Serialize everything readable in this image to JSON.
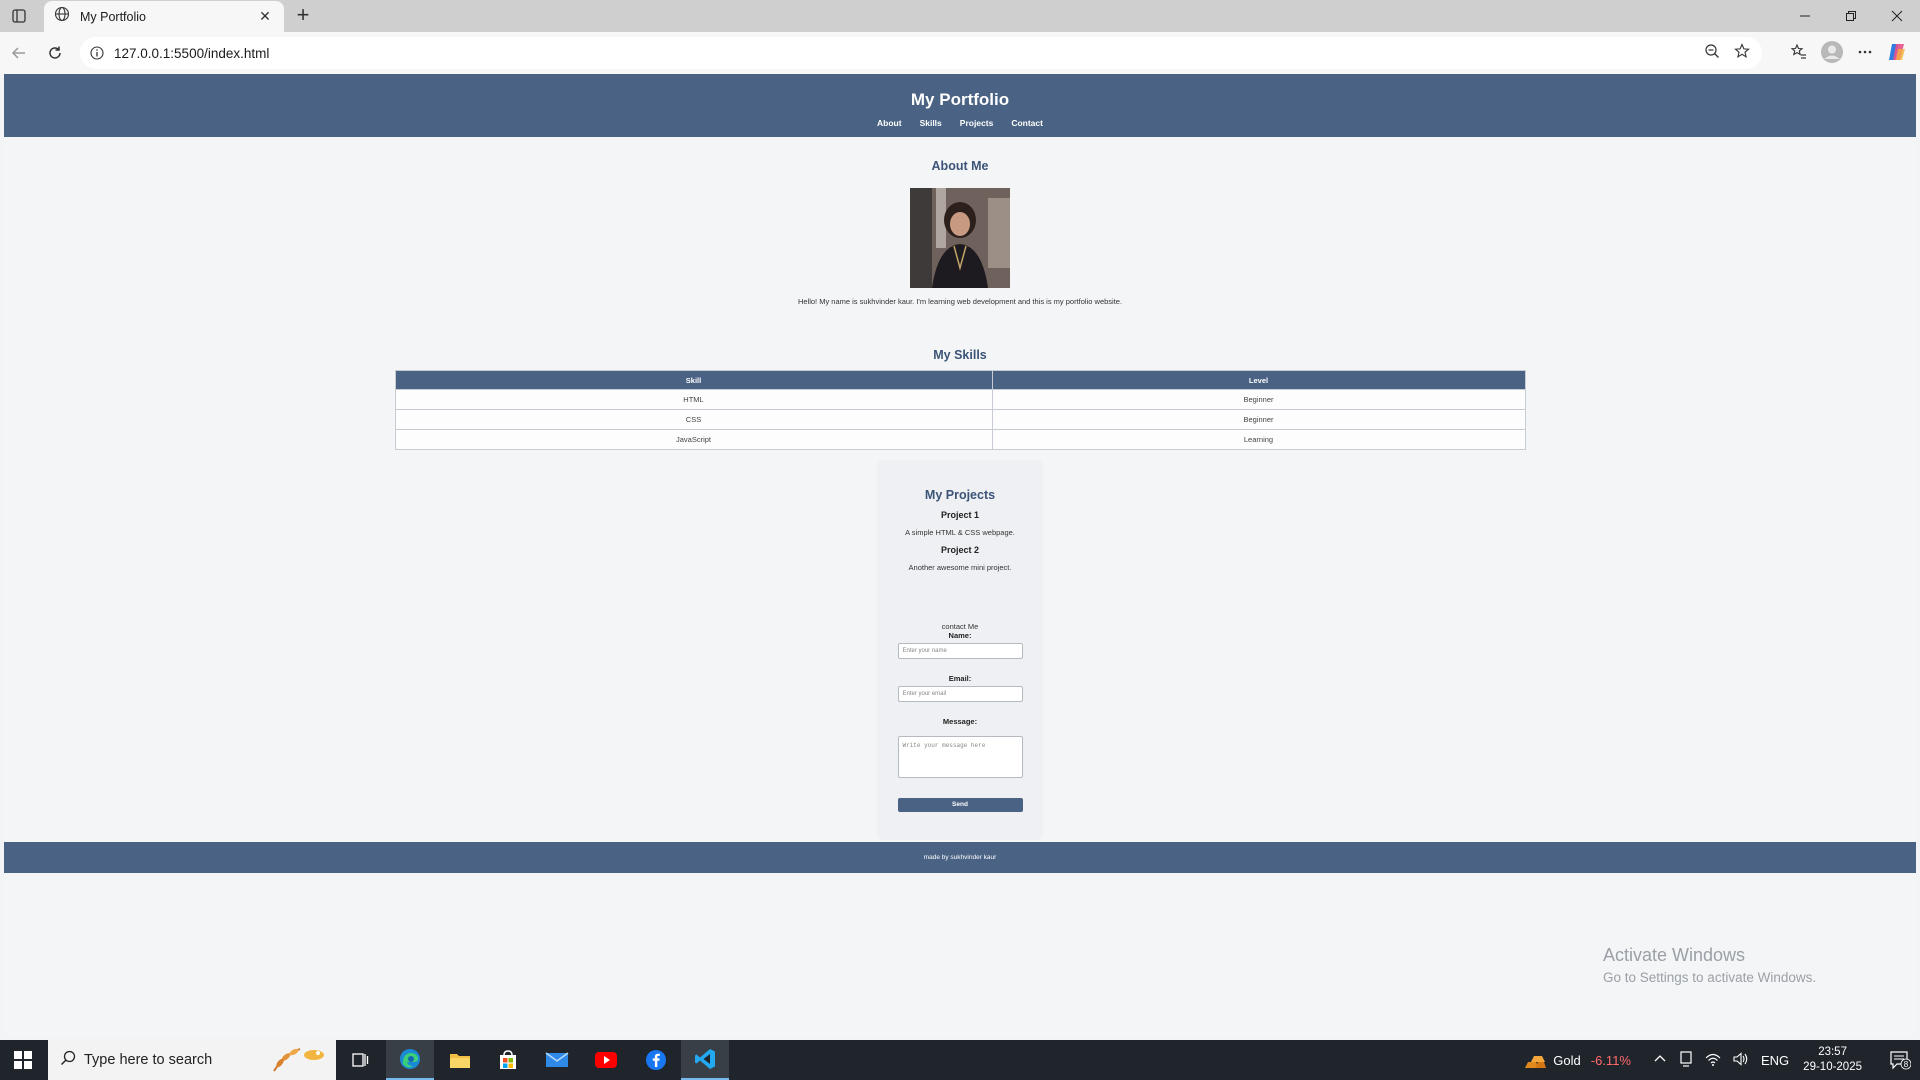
{
  "browser": {
    "tab_title": "My Portfolio",
    "tab_close": "✕",
    "new_tab": "+",
    "url": "127.0.0.1:5500/index.html"
  },
  "site": {
    "title": "My Portfolio",
    "nav": [
      "About",
      "Skills",
      "Projects",
      "Contact"
    ],
    "about": {
      "heading": "About Me",
      "text": "Hello! My name is sukhvinder kaur. I'm learning web development and this is my portfolio website."
    },
    "skills": {
      "heading": "My Skills",
      "headers": [
        "Skill",
        "Level"
      ],
      "rows": [
        [
          "HTML",
          "Beginner"
        ],
        [
          "CSS",
          "Beginner"
        ],
        [
          "JavaScript",
          "Learning"
        ]
      ]
    },
    "projects": {
      "heading": "My Projects",
      "items": [
        {
          "title": "Project 1",
          "desc": "A simple HTML & CSS webpage."
        },
        {
          "title": "Project 2",
          "desc": "Another awesome mini project."
        }
      ]
    },
    "contact": {
      "caption": "contact Me",
      "name_label": "Name:",
      "name_placeholder": "Enter your name",
      "email_label": "Email:",
      "email_placeholder": "Enter your email",
      "message_label": "Message:",
      "message_placeholder": "Write your message here",
      "send": "Send"
    },
    "footer": "made by sukhvinder kaur"
  },
  "watermark": {
    "line1": "Activate Windows",
    "line2": "Go to Settings to activate Windows."
  },
  "taskbar": {
    "search_placeholder": "Type here to search",
    "gold_label": "Gold",
    "gold_change": "-6.11%",
    "lang": "ENG",
    "time": "23:57",
    "date": "29-10-2025",
    "notif_count": "8"
  },
  "colors": {
    "header_bg": "#4a6384",
    "heading_text": "#3c5478",
    "page_bg": "#f4f5f7"
  }
}
